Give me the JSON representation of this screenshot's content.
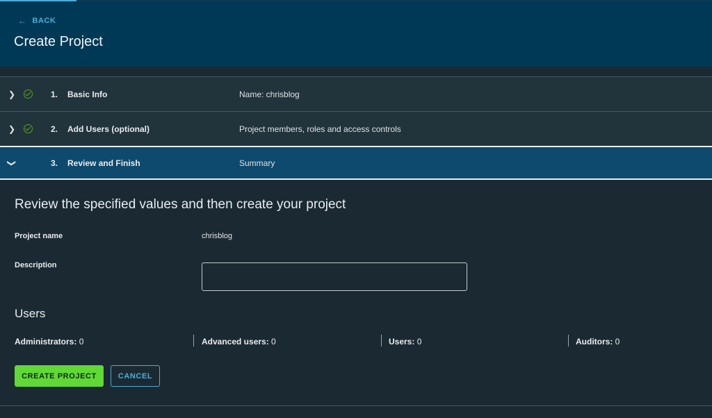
{
  "header": {
    "back_label": "BACK",
    "title": "Create Project"
  },
  "steps": [
    {
      "number": "1.",
      "title": "Basic Info",
      "description": "Name: chrisblog",
      "completed": true,
      "expanded": false
    },
    {
      "number": "2.",
      "title": "Add Users (optional)",
      "description": "Project members, roles and access controls",
      "completed": true,
      "expanded": false
    },
    {
      "number": "3.",
      "title": "Review and Finish",
      "description": "Summary",
      "completed": false,
      "expanded": true
    }
  ],
  "review": {
    "heading": "Review the specified values and then create your project",
    "project_name_label": "Project name",
    "project_name_value": "chrisblog",
    "description_label": "Description",
    "description_value": ""
  },
  "users": {
    "heading": "Users",
    "stats": [
      {
        "label": "Administrators:",
        "count": "0"
      },
      {
        "label": "Advanced users:",
        "count": "0"
      },
      {
        "label": "Users:",
        "count": "0"
      },
      {
        "label": "Auditors:",
        "count": "0"
      }
    ]
  },
  "actions": {
    "create_label": "CREATE PROJECT",
    "cancel_label": "CANCEL"
  },
  "colors": {
    "header_bg": "#003956",
    "accent": "#49afd9",
    "primary_button": "#60d836",
    "success_check": "#5aa220",
    "active_step_bg": "#0e4a6d"
  },
  "icons": {
    "back": "arrow-left-icon",
    "collapsed": "chevron-right-icon",
    "expanded": "chevron-down-icon",
    "completed": "check-circle-icon"
  }
}
